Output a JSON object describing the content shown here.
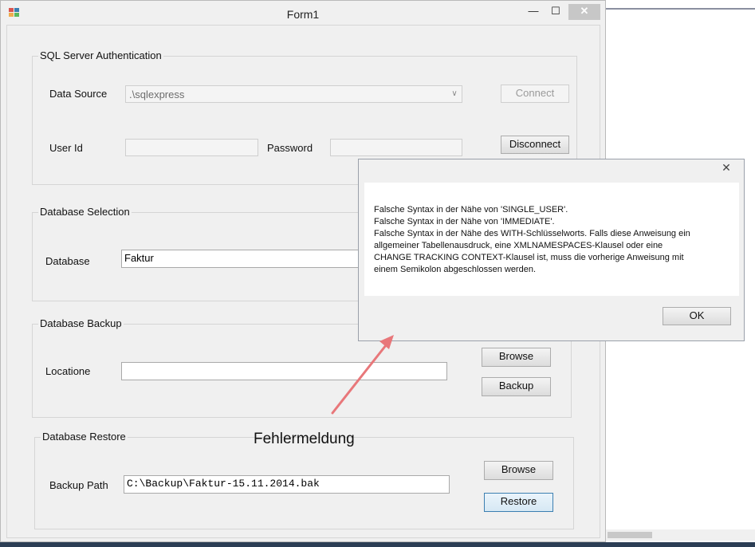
{
  "window": {
    "title": "Form1",
    "minimize": "—",
    "maximize": "☐",
    "close": "✕"
  },
  "auth": {
    "group_label": "SQL Server Authentication",
    "data_source_label": "Data Source",
    "data_source_value": ".\\sqlexpress",
    "connect_label": "Connect",
    "user_id_label": "User Id",
    "user_id_value": "",
    "password_label": "Password",
    "password_value": "",
    "disconnect_label": "Disconnect"
  },
  "selection": {
    "group_label": "Database Selection",
    "database_label": "Database",
    "database_value": "Faktur"
  },
  "backup": {
    "group_label": "Database Backup",
    "location_label": "Locatione",
    "location_value": "",
    "browse_label": "Browse",
    "backup_label": "Backup"
  },
  "restore": {
    "group_label": "Database Restore",
    "path_label": "Backup Path",
    "path_value": "C:\\Backup\\Faktur-15.11.2014.bak",
    "browse_label": "Browse",
    "restore_label": "Restore"
  },
  "message_box": {
    "close": "✕",
    "lines": [
      "Falsche Syntax in der Nähe von 'SINGLE_USER'.",
      "Falsche Syntax in der Nähe von 'IMMEDIATE'.",
      "Falsche Syntax in der Nähe des WITH-Schlüsselworts. Falls diese Anweisung ein",
      "allgemeiner Tabellenausdruck, eine XMLNAMESPACES-Klausel oder eine",
      "CHANGE TRACKING CONTEXT-Klausel ist, muss die vorherige Anweisung mit",
      "einem Semikolon abgeschlossen werden."
    ],
    "ok_label": "OK"
  },
  "annotation": {
    "text": "Fehlermeldung",
    "color": "#e8777a"
  }
}
